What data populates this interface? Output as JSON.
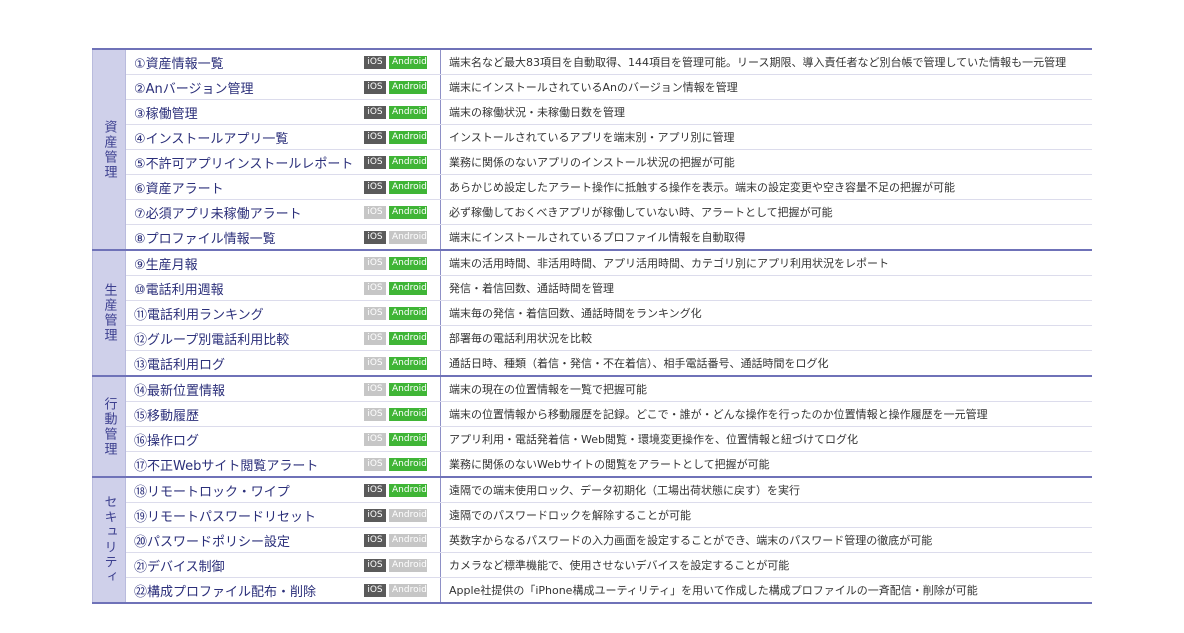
{
  "groups": [
    {
      "category": "資産管理",
      "rows": [
        {
          "name": "①資産情報一覧",
          "ios": "on",
          "android": "on",
          "desc": "端末名など最大83項目を自動取得、144項目を管理可能。リース期限、導入責任者など別台帳で管理していた情報も一元管理"
        },
        {
          "name": "②Anバージョン管理",
          "ios": "on",
          "android": "on",
          "desc": "端末にインストールされているAnのバージョン情報を管理"
        },
        {
          "name": "③稼働管理",
          "ios": "on",
          "android": "on",
          "desc": "端末の稼働状況・未稼働日数を管理"
        },
        {
          "name": "④インストールアプリ一覧",
          "ios": "on",
          "android": "on",
          "desc": "インストールされているアプリを端末別・アプリ別に管理"
        },
        {
          "name": "⑤不許可アプリインストールレポート",
          "ios": "on",
          "android": "on",
          "desc": "業務に関係のないアプリのインストール状況の把握が可能"
        },
        {
          "name": "⑥資産アラート",
          "ios": "on",
          "android": "on",
          "desc": "あらかじめ設定したアラート操作に抵触する操作を表示。端末の設定変更や空き容量不足の把握が可能"
        },
        {
          "name": "⑦必須アプリ未稼働アラート",
          "ios": "off",
          "android": "on",
          "desc": "必ず稼働しておくべきアプリが稼働していない時、アラートとして把握が可能"
        },
        {
          "name": "⑧プロファイル情報一覧",
          "ios": "on",
          "android": "off",
          "desc": "端末にインストールされているプロファイル情報を自動取得"
        }
      ]
    },
    {
      "category": "生産管理",
      "rows": [
        {
          "name": "⑨生産月報",
          "ios": "off",
          "android": "on",
          "desc": "端末の活用時間、非活用時間、アプリ活用時間、カテゴリ別にアプリ利用状況をレポート"
        },
        {
          "name": "⑩電話利用週報",
          "ios": "off",
          "android": "on",
          "desc": "発信・着信回数、通話時間を管理"
        },
        {
          "name": "⑪電話利用ランキング",
          "ios": "off",
          "android": "on",
          "desc": "端末毎の発信・着信回数、通話時間をランキング化"
        },
        {
          "name": "⑫グループ別電話利用比較",
          "ios": "off",
          "android": "on",
          "desc": "部署毎の電話利用状況を比較"
        },
        {
          "name": "⑬電話利用ログ",
          "ios": "off",
          "android": "on",
          "desc": "通話日時、種類（着信・発信・不在着信）、相手電話番号、通話時間をログ化"
        }
      ]
    },
    {
      "category": "行動管理",
      "rows": [
        {
          "name": "⑭最新位置情報",
          "ios": "off",
          "android": "on",
          "desc": "端末の現在の位置情報を一覧で把握可能"
        },
        {
          "name": "⑮移動履歴",
          "ios": "off",
          "android": "on",
          "desc": "端末の位置情報から移動履歴を記録。どこで・誰が・どんな操作を行ったのか位置情報と操作履歴を一元管理"
        },
        {
          "name": "⑯操作ログ",
          "ios": "off",
          "android": "on",
          "desc": "アプリ利用・電話発着信・Web閲覧・環境変更操作を、位置情報と紐づけてログ化"
        },
        {
          "name": "⑰不正Webサイト閲覧アラート",
          "ios": "off",
          "android": "on",
          "desc": "業務に関係のないWebサイトの閲覧をアラートとして把握が可能"
        }
      ]
    },
    {
      "category": "セキュリティ",
      "rows": [
        {
          "name": "⑱リモートロック・ワイプ",
          "ios": "on",
          "android": "on",
          "desc": "遠隔での端末使用ロック、データ初期化（工場出荷状態に戻す）を実行"
        },
        {
          "name": "⑲リモートパスワードリセット",
          "ios": "on",
          "android": "off",
          "desc": "遠隔でのパスワードロックを解除することが可能"
        },
        {
          "name": "⑳パスワードポリシー設定",
          "ios": "on",
          "android": "off",
          "desc": "英数字からなるパスワードの入力画面を設定することができ、端末のパスワード管理の徹底が可能"
        },
        {
          "name": "㉑デバイス制御",
          "ios": "on",
          "android": "off",
          "desc": "カメラなど標準機能で、使用させないデバイスを設定することが可能"
        },
        {
          "name": "㉒構成プロファイル配布・削除",
          "ios": "on",
          "android": "off",
          "desc": "Apple社提供の「iPhone構成ユーティリティ」を用いて作成した構成プロファイルの一斉配信・削除が可能"
        }
      ]
    }
  ],
  "badge_labels": {
    "ios": "iOS",
    "android": "Android"
  },
  "colors": {
    "accent": "#6f72b8",
    "category_bg": "#cfd0ea",
    "ios_on": "#5a5a5a",
    "android_on": "#3fb536",
    "badge_off": "#c6c6c6"
  }
}
